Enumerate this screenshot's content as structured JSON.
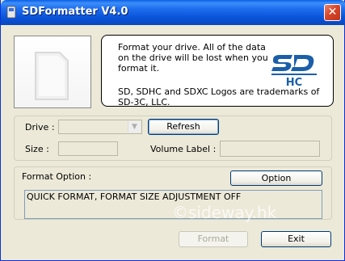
{
  "window": {
    "title": "SDFormatter V4.0",
    "close_glyph": "✕"
  },
  "notice": {
    "message": "Format your drive. All of the data on the drive will be lost when you format it.",
    "trademark": "SD, SDHC and SDXC Logos are trademarks of SD-3C, LLC.",
    "logo_text": "HC"
  },
  "drive_group": {
    "drive_label": "Drive :",
    "drive_value": "",
    "refresh_label": "Refresh",
    "size_label": "Size  :",
    "size_value": "",
    "volume_label": "Volume Label  :",
    "volume_value": ""
  },
  "format_group": {
    "title": "Format Option :",
    "option_label": "Option",
    "option_text": "QUICK FORMAT, FORMAT SIZE ADJUSTMENT OFF"
  },
  "actions": {
    "format_label": "Format",
    "exit_label": "Exit"
  },
  "watermark": "©sideway.hk",
  "colors": {
    "titlebar": "#0a53d8",
    "close": "#d6462a",
    "face": "#ece9d8"
  }
}
